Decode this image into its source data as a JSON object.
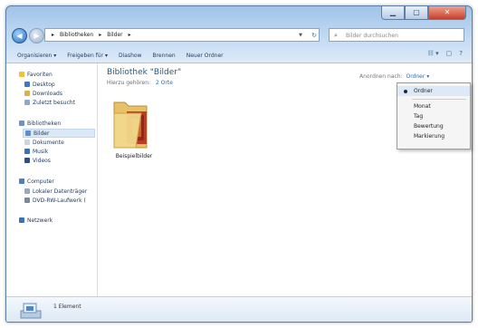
{
  "window": {
    "caption_buttons": {
      "minimize": "▁",
      "maximize": "▢",
      "close": "✕"
    }
  },
  "nav": {
    "back": "◀",
    "forward": "▶"
  },
  "address": {
    "crumbs": [
      "▸",
      "Bibliotheken",
      "▸",
      "Bilder",
      "▸"
    ],
    "refresh": "↻",
    "dropdown": "▼"
  },
  "search": {
    "placeholder": "Bilder durchsuchen"
  },
  "toolbar": {
    "organize": "Organisieren ▾",
    "share": "Freigeben für ▾",
    "slideshow": "Diashow",
    "burn": "Brennen",
    "new_folder": "Neuer Ordner"
  },
  "navpane": {
    "favorites": "Favoriten",
    "desktop": "Desktop",
    "downloads": "Downloads",
    "recent": "Zuletzt besucht",
    "libraries": "Bibliotheken",
    "pictures": "Bilder",
    "documents": "Dokumente",
    "music": "Musik",
    "videos": "Videos",
    "computer": "Computer",
    "local_disk": "Lokaler Datenträger",
    "dvd_drive": "DVD-RW-Laufwerk (",
    "network": "Netzwerk"
  },
  "main": {
    "title": "Bibliothek \"Bilder\"",
    "subtitle": "Hierzu gehören:",
    "locations_link": "2 Orte",
    "arrange_label": "Anordnen nach:",
    "arrange_value": "Ordner ▾",
    "folder_name": "Beispielbilder"
  },
  "menu": {
    "items": [
      "Ordner",
      "Monat",
      "Tag",
      "Bewertung",
      "Markierung"
    ],
    "selected_index": 0
  },
  "details": {
    "count": "1 Element"
  },
  "colors": {
    "title_text": "#1e5b8a",
    "link": "#2e6db5",
    "close_button": "#c4412b",
    "selection": "#dbe8f6"
  }
}
